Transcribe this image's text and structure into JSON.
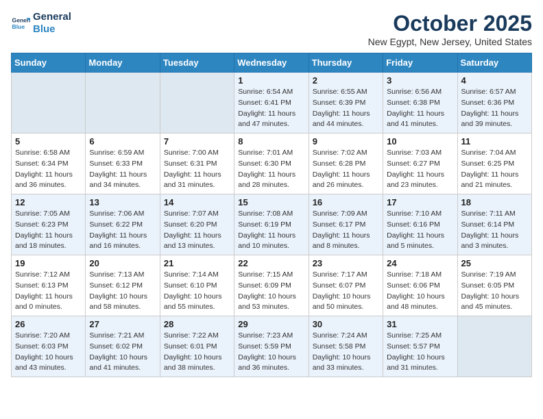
{
  "logo": {
    "text_general": "General",
    "text_blue": "Blue"
  },
  "header": {
    "month": "October 2025",
    "location": "New Egypt, New Jersey, United States"
  },
  "weekdays": [
    "Sunday",
    "Monday",
    "Tuesday",
    "Wednesday",
    "Thursday",
    "Friday",
    "Saturday"
  ],
  "weeks": [
    [
      {
        "day": "",
        "info": ""
      },
      {
        "day": "",
        "info": ""
      },
      {
        "day": "",
        "info": ""
      },
      {
        "day": "1",
        "info": "Sunrise: 6:54 AM\nSunset: 6:41 PM\nDaylight: 11 hours\nand 47 minutes."
      },
      {
        "day": "2",
        "info": "Sunrise: 6:55 AM\nSunset: 6:39 PM\nDaylight: 11 hours\nand 44 minutes."
      },
      {
        "day": "3",
        "info": "Sunrise: 6:56 AM\nSunset: 6:38 PM\nDaylight: 11 hours\nand 41 minutes."
      },
      {
        "day": "4",
        "info": "Sunrise: 6:57 AM\nSunset: 6:36 PM\nDaylight: 11 hours\nand 39 minutes."
      }
    ],
    [
      {
        "day": "5",
        "info": "Sunrise: 6:58 AM\nSunset: 6:34 PM\nDaylight: 11 hours\nand 36 minutes."
      },
      {
        "day": "6",
        "info": "Sunrise: 6:59 AM\nSunset: 6:33 PM\nDaylight: 11 hours\nand 34 minutes."
      },
      {
        "day": "7",
        "info": "Sunrise: 7:00 AM\nSunset: 6:31 PM\nDaylight: 11 hours\nand 31 minutes."
      },
      {
        "day": "8",
        "info": "Sunrise: 7:01 AM\nSunset: 6:30 PM\nDaylight: 11 hours\nand 28 minutes."
      },
      {
        "day": "9",
        "info": "Sunrise: 7:02 AM\nSunset: 6:28 PM\nDaylight: 11 hours\nand 26 minutes."
      },
      {
        "day": "10",
        "info": "Sunrise: 7:03 AM\nSunset: 6:27 PM\nDaylight: 11 hours\nand 23 minutes."
      },
      {
        "day": "11",
        "info": "Sunrise: 7:04 AM\nSunset: 6:25 PM\nDaylight: 11 hours\nand 21 minutes."
      }
    ],
    [
      {
        "day": "12",
        "info": "Sunrise: 7:05 AM\nSunset: 6:23 PM\nDaylight: 11 hours\nand 18 minutes."
      },
      {
        "day": "13",
        "info": "Sunrise: 7:06 AM\nSunset: 6:22 PM\nDaylight: 11 hours\nand 16 minutes."
      },
      {
        "day": "14",
        "info": "Sunrise: 7:07 AM\nSunset: 6:20 PM\nDaylight: 11 hours\nand 13 minutes."
      },
      {
        "day": "15",
        "info": "Sunrise: 7:08 AM\nSunset: 6:19 PM\nDaylight: 11 hours\nand 10 minutes."
      },
      {
        "day": "16",
        "info": "Sunrise: 7:09 AM\nSunset: 6:17 PM\nDaylight: 11 hours\nand 8 minutes."
      },
      {
        "day": "17",
        "info": "Sunrise: 7:10 AM\nSunset: 6:16 PM\nDaylight: 11 hours\nand 5 minutes."
      },
      {
        "day": "18",
        "info": "Sunrise: 7:11 AM\nSunset: 6:14 PM\nDaylight: 11 hours\nand 3 minutes."
      }
    ],
    [
      {
        "day": "19",
        "info": "Sunrise: 7:12 AM\nSunset: 6:13 PM\nDaylight: 11 hours\nand 0 minutes."
      },
      {
        "day": "20",
        "info": "Sunrise: 7:13 AM\nSunset: 6:12 PM\nDaylight: 10 hours\nand 58 minutes."
      },
      {
        "day": "21",
        "info": "Sunrise: 7:14 AM\nSunset: 6:10 PM\nDaylight: 10 hours\nand 55 minutes."
      },
      {
        "day": "22",
        "info": "Sunrise: 7:15 AM\nSunset: 6:09 PM\nDaylight: 10 hours\nand 53 minutes."
      },
      {
        "day": "23",
        "info": "Sunrise: 7:17 AM\nSunset: 6:07 PM\nDaylight: 10 hours\nand 50 minutes."
      },
      {
        "day": "24",
        "info": "Sunrise: 7:18 AM\nSunset: 6:06 PM\nDaylight: 10 hours\nand 48 minutes."
      },
      {
        "day": "25",
        "info": "Sunrise: 7:19 AM\nSunset: 6:05 PM\nDaylight: 10 hours\nand 45 minutes."
      }
    ],
    [
      {
        "day": "26",
        "info": "Sunrise: 7:20 AM\nSunset: 6:03 PM\nDaylight: 10 hours\nand 43 minutes."
      },
      {
        "day": "27",
        "info": "Sunrise: 7:21 AM\nSunset: 6:02 PM\nDaylight: 10 hours\nand 41 minutes."
      },
      {
        "day": "28",
        "info": "Sunrise: 7:22 AM\nSunset: 6:01 PM\nDaylight: 10 hours\nand 38 minutes."
      },
      {
        "day": "29",
        "info": "Sunrise: 7:23 AM\nSunset: 5:59 PM\nDaylight: 10 hours\nand 36 minutes."
      },
      {
        "day": "30",
        "info": "Sunrise: 7:24 AM\nSunset: 5:58 PM\nDaylight: 10 hours\nand 33 minutes."
      },
      {
        "day": "31",
        "info": "Sunrise: 7:25 AM\nSunset: 5:57 PM\nDaylight: 10 hours\nand 31 minutes."
      },
      {
        "day": "",
        "info": ""
      }
    ]
  ]
}
